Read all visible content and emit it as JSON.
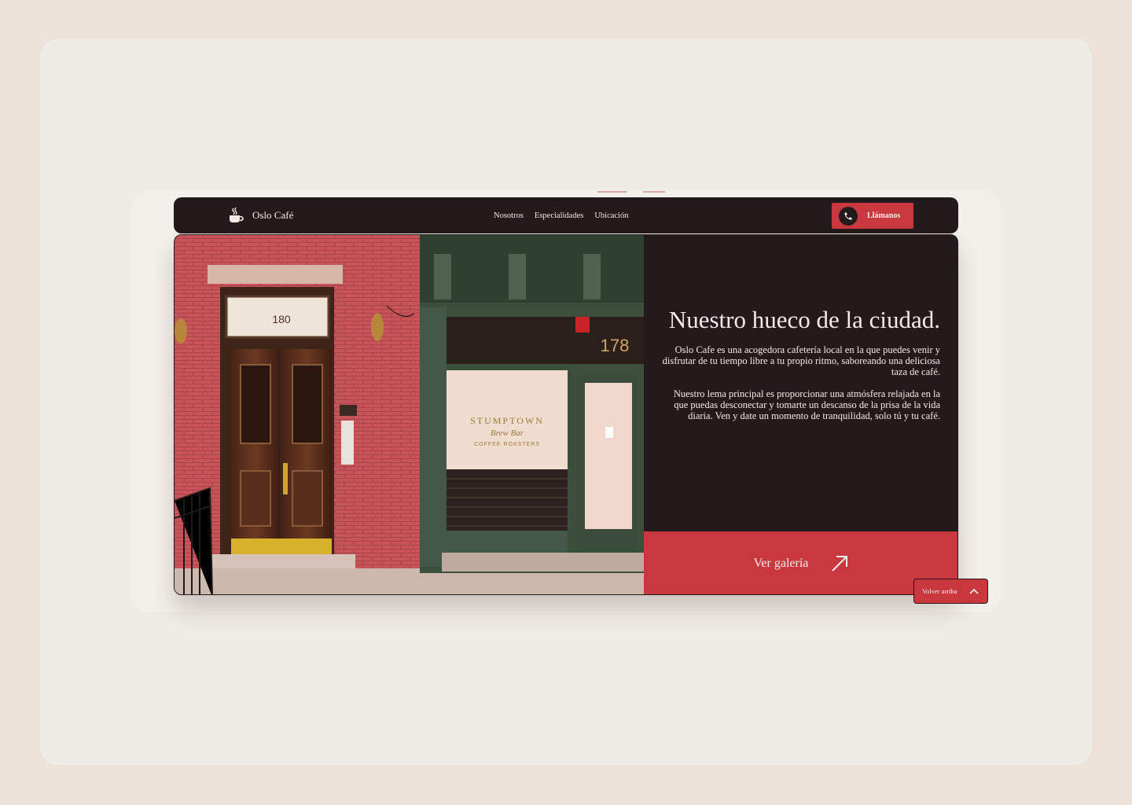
{
  "brand": {
    "name": "Oslo Café",
    "icon": "coffee-cup-icon"
  },
  "nav": {
    "items": [
      {
        "label": "Nosotros"
      },
      {
        "label": "Especialidades"
      },
      {
        "label": "Ubicación"
      }
    ]
  },
  "cta": {
    "label": "Llámanos",
    "icon": "phone-icon"
  },
  "photo": {
    "description_icon": "storefront-photo",
    "texts": {
      "door_number": "180",
      "shop_number": "178",
      "sign_line1": "STUMPTOWN",
      "sign_line2": "Brew Bar",
      "sign_line3": "COFFEE ROASTERS"
    }
  },
  "hero": {
    "title": "Nuestro hueco de la ciudad.",
    "paragraph1": "Oslo Cafe es una acogedora cafetería local en la que puedes venir y disfrutar de tu tiempo libre a tu propio ritmo, saboreando una deliciosa taza de café.",
    "paragraph2": "Nuestro lema principal es proporcionar una atmósfera relajada en la que puedas desconectar y tomarte un descanso de la prisa de la vida diaria. Ven y date un momento de tranquilidad, solo tú y tu café."
  },
  "gallery": {
    "label": "Ver galería",
    "icon": "arrow-up-right-icon"
  },
  "back_to_top": {
    "label": "Volver arriba",
    "icon": "chevron-up-icon"
  },
  "colors": {
    "dark": "#231b1b",
    "accent": "#c9383f",
    "page_bg": "#ede3da",
    "card_bg": "#efebe7",
    "text_light": "#f3ece6"
  }
}
